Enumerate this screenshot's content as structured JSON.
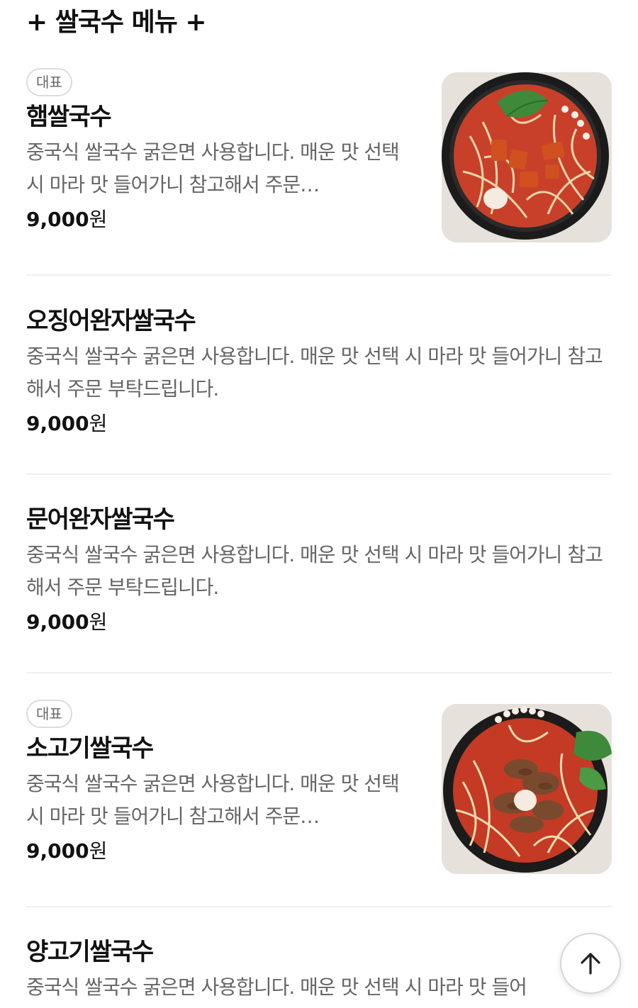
{
  "section": {
    "title": "+ 쌀국수 메뉴 +"
  },
  "items": [
    {
      "badge": "대표",
      "name": "햄쌀국수",
      "description": "중국식 쌀국수 굵은면 사용합니다. 매운 맛 선택 시 마라 맛 들어가니 참고해서 주문…",
      "price": "9,000",
      "currency": "원",
      "has_image": true
    },
    {
      "name": "오징어완자쌀국수",
      "description": "중국식 쌀국수 굵은면 사용합니다. 매운 맛 선택 시 마라 맛 들어가니 참고해서 주문 부탁드립니다.",
      "price": "9,000",
      "currency": "원",
      "has_image": false
    },
    {
      "name": "문어완자쌀국수",
      "description": "중국식 쌀국수 굵은면 사용합니다. 매운 맛 선택 시 마라 맛 들어가니 참고해서 주문 부탁드립니다.",
      "price": "9,000",
      "currency": "원",
      "has_image": false
    },
    {
      "badge": "대표",
      "name": "소고기쌀국수",
      "description": "중국식 쌀국수 굵은면 사용합니다. 매운 맛 선택 시 마라 맛 들어가니 참고해서 주문…",
      "price": "9,000",
      "currency": "원",
      "has_image": true
    },
    {
      "name": "양고기쌀국수",
      "description": "중국식 쌀국수 굵은면 사용합니다. 매운 맛 선택 시 마라 맛 들어",
      "has_image": false
    }
  ],
  "scroll_top": {
    "icon": "arrow-up-icon"
  },
  "colors": {
    "text_primary": "#111111",
    "text_secondary": "#666666",
    "divider": "#efefef",
    "badge_border": "#dcdcdc",
    "broth": "#c8402a",
    "bowl": "#1b1b1b"
  }
}
